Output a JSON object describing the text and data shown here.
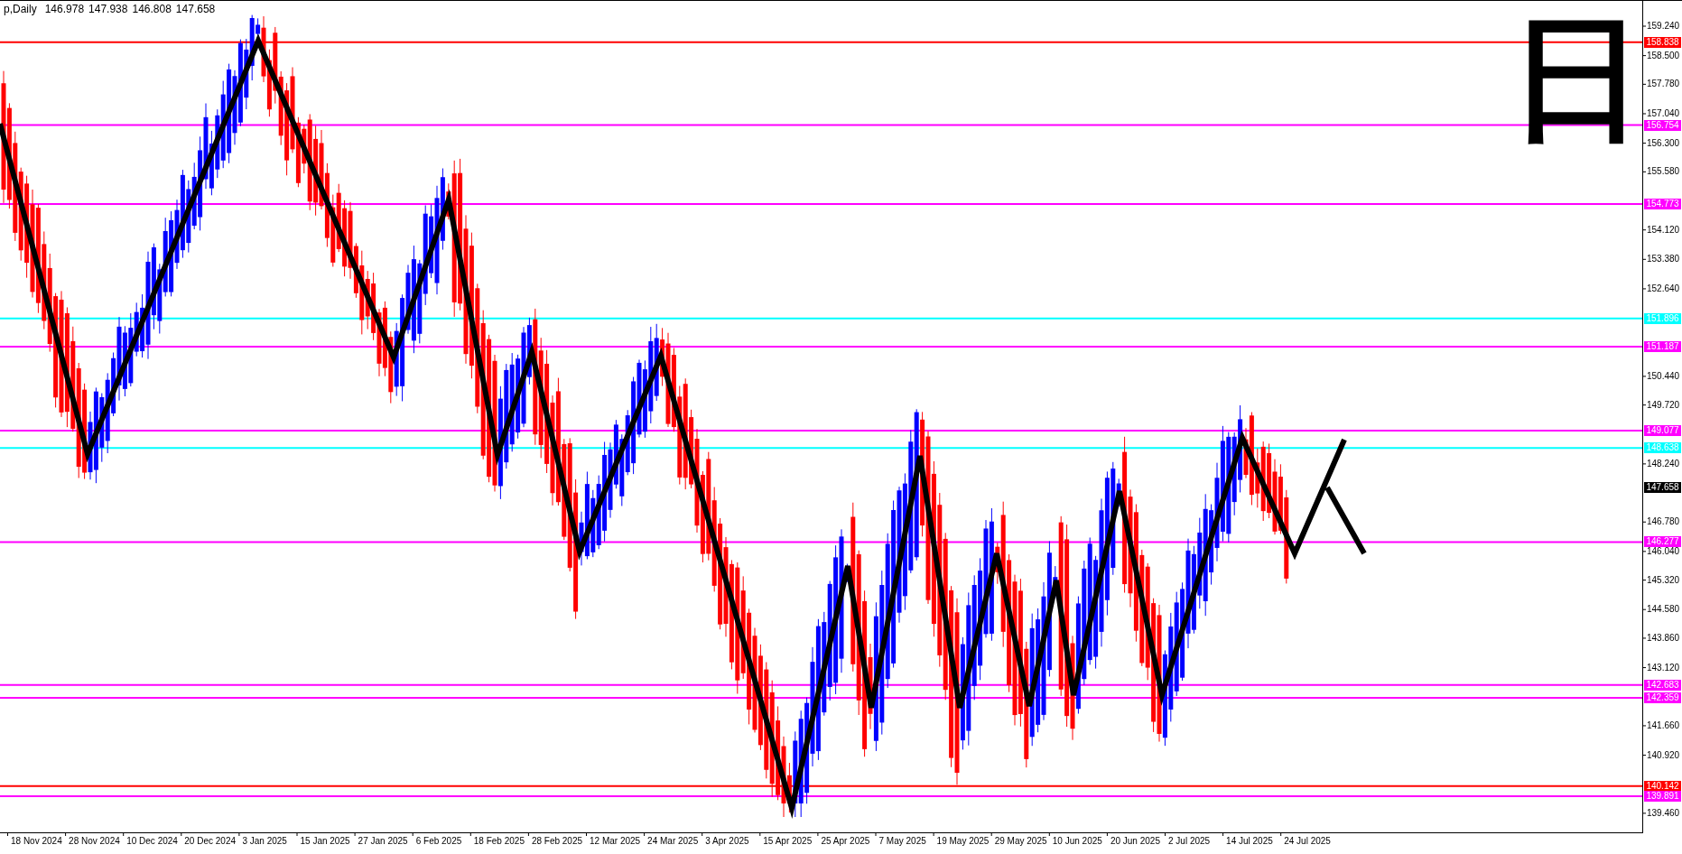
{
  "header": {
    "title": "p,Daily",
    "values": [
      "146.978",
      "147.938",
      "146.808",
      "147.658"
    ]
  },
  "timeframe_glyph": "日",
  "price_axis": {
    "ticks": [
      "159.240",
      "158.500",
      "157.780",
      "157.040",
      "156.300",
      "155.580",
      "154.120",
      "153.380",
      "152.640",
      "150.440",
      "149.720",
      "148.240",
      "146.780",
      "146.040",
      "145.320",
      "144.580",
      "143.860",
      "143.120",
      "141.660",
      "140.920",
      "139.460"
    ]
  },
  "levels": [
    {
      "label": "158.838",
      "color": "#ff0000"
    },
    {
      "label": "156.754",
      "color": "#ff00ff"
    },
    {
      "label": "154.773",
      "color": "#ff00ff"
    },
    {
      "label": "151.896",
      "color": "#00ffff"
    },
    {
      "label": "151.187",
      "color": "#ff00ff"
    },
    {
      "label": "149.077",
      "color": "#ff00ff"
    },
    {
      "label": "148.638",
      "color": "#00ffff"
    },
    {
      "label": "146.277",
      "color": "#ff00ff"
    },
    {
      "label": "142.683",
      "color": "#ff00ff"
    },
    {
      "label": "142.359",
      "color": "#ff00ff"
    },
    {
      "label": "140.142",
      "color": "#ff0000"
    },
    {
      "label": "139.891",
      "color": "#ff00ff"
    }
  ],
  "last_price": "147.658",
  "time_axis": {
    "labels": [
      "18 Nov 2024",
      "28 Nov 2024",
      "10 Dec 2024",
      "20 Dec 2024",
      "3 Jan 2025",
      "15 Jan 2025",
      "27 Jan 2025",
      "6 Feb 2025",
      "18 Feb 2025",
      "28 Feb 2025",
      "12 Mar 2025",
      "24 Mar 2025",
      "3 Apr 2025",
      "15 Apr 2025",
      "25 Apr 2025",
      "7 May 2025",
      "19 May 2025",
      "29 May 2025",
      "10 Jun 2025",
      "20 Jun 2025",
      "2 Jul 2025",
      "14 Jul 2025",
      "24 Jul 2025"
    ]
  }
}
